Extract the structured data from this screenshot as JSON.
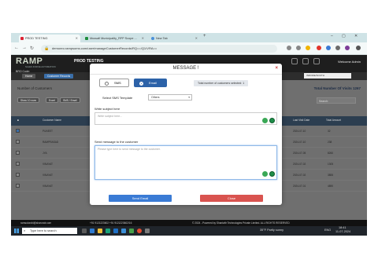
{
  "browser": {
    "tabs": [
      {
        "label": "PROD TESTING",
        "active": true
      },
      {
        "label": "Mussafi Municipality_RFP Scope ...",
        "active": false
      },
      {
        "label": "New Tab",
        "active": false
      }
    ],
    "url": "demoreo.rampsoms.com/user/manageCustomerRecords/RQ==/Q1/VRA==",
    "new_tab": "+"
  },
  "app": {
    "logo": "RAMP",
    "logo_sub": "SALES FORCE AUTOMATION",
    "env_tag": "PROD TESTING",
    "bro_code": "BRO Code:",
    "welcome": "Welcome Admin",
    "breadcrumbs": [
      "Home",
      "Customer Records"
    ],
    "header_select": "INDORE/SOUTH"
  },
  "page": {
    "title": "Number of Customers",
    "total_visits": "Total Number Of Visits 1267",
    "buttons": [
      "Show 10 rows",
      "Excel",
      "SMS / Email"
    ],
    "search_label": "Search:",
    "columns": [
      "",
      "Customer Name",
      "Last Visit Date",
      "Total Amount"
    ],
    "rows": [
      {
        "checked": true,
        "name": "PUNEET",
        "date": "2024-07-10",
        "amount": "32"
      },
      {
        "checked": false,
        "name": "RAMPRASAD",
        "date": "2024-07-10",
        "amount": "238"
      },
      {
        "checked": false,
        "name": "JYA",
        "date": "2024-07-05",
        "amount": "8260"
      },
      {
        "checked": false,
        "name": "VINAYAT",
        "date": "2024-07-02",
        "amount": "1305"
      },
      {
        "checked": false,
        "name": "VINAYAT",
        "date": "2024-07-02",
        "amount": "3855"
      },
      {
        "checked": false,
        "name": "VINAYAT",
        "date": "2024-07-01",
        "amount": "4890"
      }
    ]
  },
  "modal": {
    "title": "MESSAGE !",
    "close": "×",
    "options": [
      {
        "label": "SMS",
        "selected": false
      },
      {
        "label": "Email",
        "selected": true
      }
    ],
    "total_selected": "Total number of customers selected: 1",
    "template_label": "Select SMS Template",
    "template_value": "Others",
    "subject_label": "Write subject here",
    "subject_placeholder": "Write subject here...",
    "message_label": "Send message to the customer",
    "message_placeholder": "Please type here to send message to the customer.",
    "send_button": "Send Email",
    "close_button": "Close",
    "colors": {
      "send": "#3a7bd5",
      "close": "#d9534f",
      "email_selected": "#2c62a8"
    }
  },
  "footer": {
    "email": "ramsolorobi@sharondr.com",
    "phone": "+91 9121223602  +91 9121223602/16",
    "copyright": "© 2024 - Powered by Shantaftr Technologies Private Limited. ALL RIGHTS RESERVED"
  },
  "taskbar": {
    "search_placeholder": "Type here to search",
    "weather": "35°F  Partly sunny",
    "lang": "ENG",
    "time": "18:41",
    "date": "11-07-2024"
  }
}
